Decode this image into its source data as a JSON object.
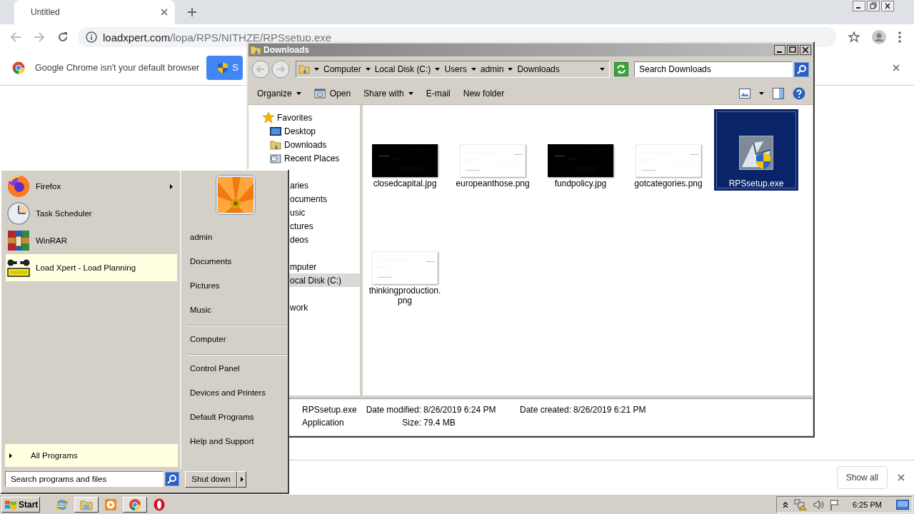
{
  "browser": {
    "tab": {
      "title": "Untitled"
    },
    "address": {
      "host": "loadxpert.com",
      "path": "/lopa/RPS/NITHZE/RPSsetup.exe"
    },
    "infobar": {
      "message": "Google Chrome isn't your default browser",
      "button": "S"
    },
    "download_bar": {
      "button": "Show all"
    }
  },
  "explorer": {
    "title": "Downloads",
    "breadcrumb": [
      "Computer",
      "Local Disk (C:)",
      "Users",
      "admin",
      "Downloads"
    ],
    "search": {
      "placeholder": "Search Downloads"
    },
    "commands": [
      {
        "label": "Organize",
        "kind": "menu"
      },
      {
        "label": "Open",
        "kind": "open"
      },
      {
        "label": "Share with",
        "kind": "menu"
      },
      {
        "label": "E-mail",
        "kind": "action"
      },
      {
        "label": "New folder",
        "kind": "action"
      }
    ],
    "nav": [
      {
        "label": "Favorites",
        "kind": "favorites",
        "selected": false,
        "children": [
          {
            "label": "Desktop",
            "kind": "desktop",
            "selected": false
          },
          {
            "label": "Downloads",
            "kind": "folder",
            "selected": false
          },
          {
            "label": "Recent Places",
            "kind": "recent",
            "selected": false
          }
        ]
      },
      {
        "label": "aries",
        "kind": "covered",
        "selected": false,
        "children": [
          {
            "label": "ocuments",
            "kind": "covered",
            "selected": false
          },
          {
            "label": "usic",
            "kind": "covered",
            "selected": false
          },
          {
            "label": "ctures",
            "kind": "covered",
            "selected": false
          },
          {
            "label": "deos",
            "kind": "covered",
            "selected": false
          }
        ]
      },
      {
        "label": "mputer",
        "kind": "covered",
        "selected": false,
        "children": [
          {
            "label": "ocal Disk (C:)",
            "kind": "covered",
            "selected": true
          }
        ]
      },
      {
        "label": "work",
        "kind": "covered",
        "selected": false
      }
    ],
    "files": [
      {
        "name": "closedcapital.jpg",
        "kind": "dark",
        "selected": false
      },
      {
        "name": "europeanthose.png",
        "kind": "light",
        "selected": false
      },
      {
        "name": "fundpolicy.jpg",
        "kind": "dark",
        "selected": false
      },
      {
        "name": "gotcategories.png",
        "kind": "light",
        "selected": false
      },
      {
        "name": "RPSsetup.exe",
        "kind": "app",
        "selected": true
      },
      {
        "name": "thinkingproduction.png",
        "kind": "light",
        "selected": false
      }
    ],
    "details": {
      "name": "RPSsetup.exe",
      "type": "Application",
      "modified_label": "Date modified:",
      "modified": "8/26/2019 6:24 PM",
      "created_label": "Date created:",
      "created": "8/26/2019 6:21 PM",
      "size_label": "Size:",
      "size": "79.4 MB"
    }
  },
  "start_menu": {
    "programs": [
      {
        "label": "Firefox",
        "kind": "firefox",
        "submenu": true,
        "highlighted": false
      },
      {
        "label": "Task Scheduler",
        "kind": "clock",
        "submenu": false,
        "highlighted": false
      },
      {
        "label": "WinRAR",
        "kind": "winrar",
        "submenu": false,
        "highlighted": false
      },
      {
        "label": "Load Xpert - Load Planning",
        "kind": "loadxpert",
        "submenu": false,
        "highlighted": true
      }
    ],
    "all_programs": {
      "label": "All Programs",
      "highlighted": true
    },
    "places": [
      {
        "label": "admin",
        "separator_before": false
      },
      {
        "label": "Documents",
        "separator_before": false
      },
      {
        "label": "Pictures",
        "separator_before": false
      },
      {
        "label": "Music",
        "separator_before": false
      },
      {
        "label": "Computer",
        "separator_before": true
      },
      {
        "label": "Control Panel",
        "separator_before": true
      },
      {
        "label": "Devices and Printers",
        "separator_before": false
      },
      {
        "label": "Default Programs",
        "separator_before": false
      },
      {
        "label": "Help and Support",
        "separator_before": false
      }
    ],
    "search": {
      "placeholder": "Search programs and files"
    },
    "shutdown": {
      "label": "Shut down"
    }
  },
  "taskbar": {
    "start": "Start",
    "apps": [
      {
        "kind": "ie",
        "open": false
      },
      {
        "kind": "explorer",
        "open": true
      },
      {
        "kind": "media",
        "open": false
      },
      {
        "kind": "chrome",
        "open": true
      },
      {
        "kind": "opera",
        "open": false
      }
    ],
    "clock": "6:25 PM"
  }
}
